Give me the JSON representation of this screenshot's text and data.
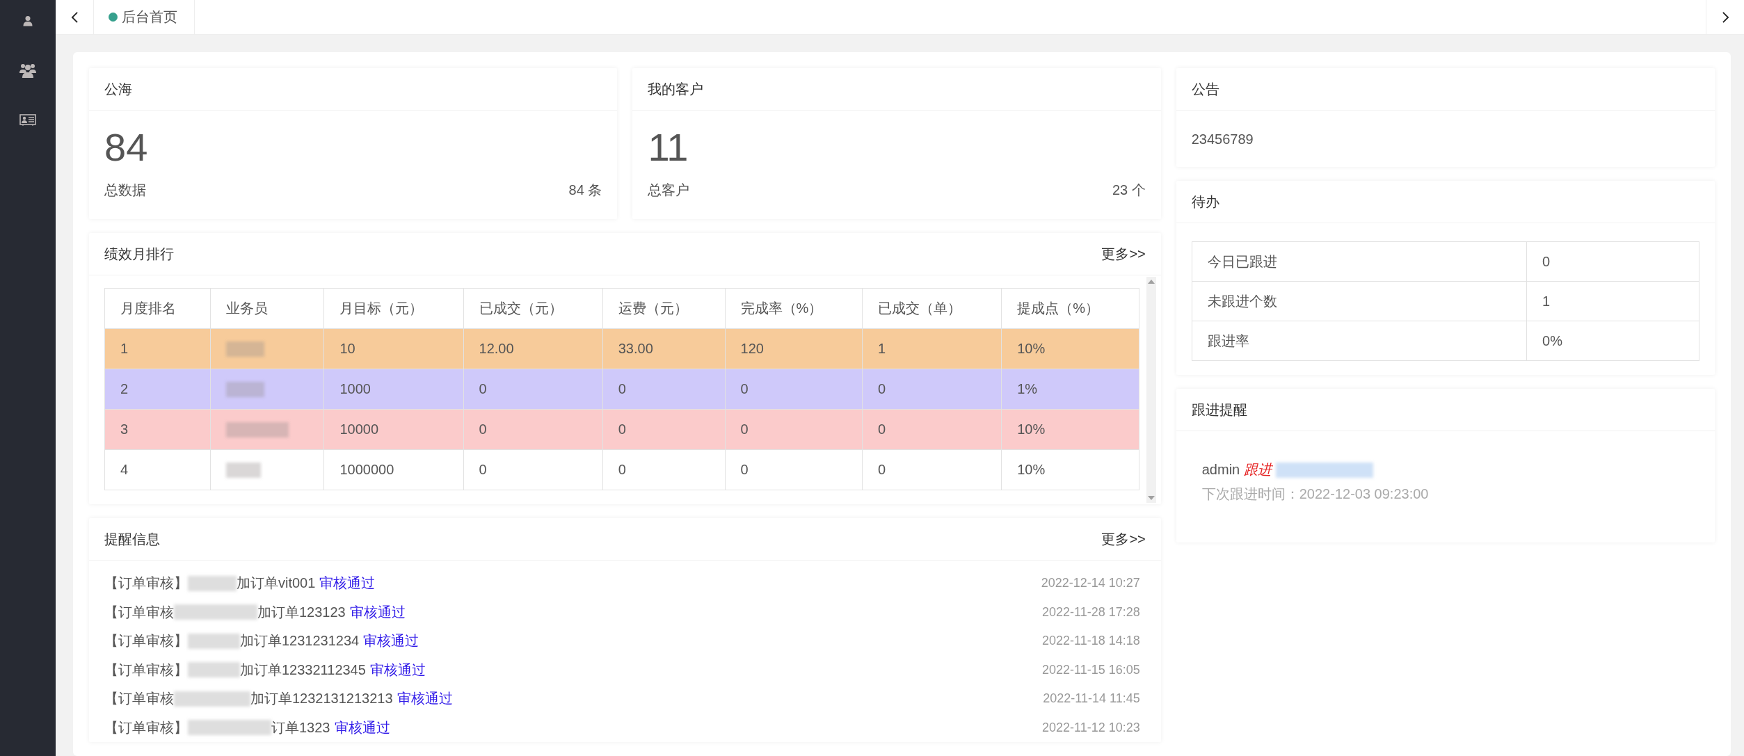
{
  "sidebar": {
    "items": [
      {
        "kind": "user"
      },
      {
        "kind": "group"
      },
      {
        "kind": "card"
      }
    ]
  },
  "tabs": [
    {
      "label": "后台首页",
      "selected": true
    }
  ],
  "stats": [
    {
      "title": "公海",
      "value": "84",
      "caption": "总数据",
      "count": "84 条"
    },
    {
      "title": "我的客户",
      "value": "11",
      "caption": "总客户",
      "count": "23 个"
    }
  ],
  "ranking": {
    "title": "绩效月排行",
    "more": "更多>>",
    "columns": [
      "月度排名",
      "业务员",
      "月目标（元）",
      "已成交（元）",
      "运费（元）",
      "完成率（%）",
      "已成交（单）",
      "提成点（%）"
    ],
    "rows": [
      {
        "color": "#f7cb9a",
        "cells": [
          "1",
          "",
          "10",
          "12.00",
          "33.00",
          "120",
          "1",
          "10%"
        ]
      },
      {
        "color": "#cfc9fa",
        "cells": [
          "2",
          "",
          "1000",
          "0",
          "0",
          "0",
          "0",
          "1%"
        ]
      },
      {
        "color": "#fbcbcb",
        "cells": [
          "3",
          "",
          "10000",
          "0",
          "0",
          "0",
          "0",
          "10%"
        ]
      },
      {
        "color": "#ffffff",
        "cells": [
          "4",
          "",
          "1000000",
          "0",
          "0",
          "0",
          "0",
          "10%"
        ]
      }
    ]
  },
  "reminders": {
    "title": "提醒信息",
    "more": "更多>>",
    "items": [
      {
        "prefix": "【订单审核】",
        "rest": "加订单vit001",
        "link": "审核通过",
        "time": "2022-12-14 10:27"
      },
      {
        "prefix": "【订单审核",
        "rest": "加订单123123",
        "link": "审核通过",
        "time": "2022-11-28 17:28"
      },
      {
        "prefix": "【订单审核】",
        "rest": "加订单1231231234",
        "link": "审核通过",
        "time": "2022-11-18 14:18"
      },
      {
        "prefix": "【订单审核】",
        "rest": "加订单12332112345",
        "link": "审核通过",
        "time": "2022-11-15 16:05"
      },
      {
        "prefix": "【订单审核",
        "rest": "加订单1232131213213",
        "link": "审核通过",
        "time": "2022-11-14 11:45"
      },
      {
        "prefix": "【订单审核】",
        "rest": "订单1323",
        "link": "审核通过",
        "time": "2022-11-12 10:23"
      }
    ]
  },
  "notice": {
    "title": "公告",
    "text": "23456789"
  },
  "todo": {
    "title": "待办",
    "rows": [
      {
        "label": "今日已跟进",
        "value": "0"
      },
      {
        "label": "未跟进个数",
        "value": "1"
      },
      {
        "label": "跟进率",
        "value": "0%"
      }
    ]
  },
  "followup": {
    "title": "跟进提醒",
    "user": "admin",
    "action": "跟进",
    "next": "下次跟进时间：2022-12-03 09:23:00"
  }
}
